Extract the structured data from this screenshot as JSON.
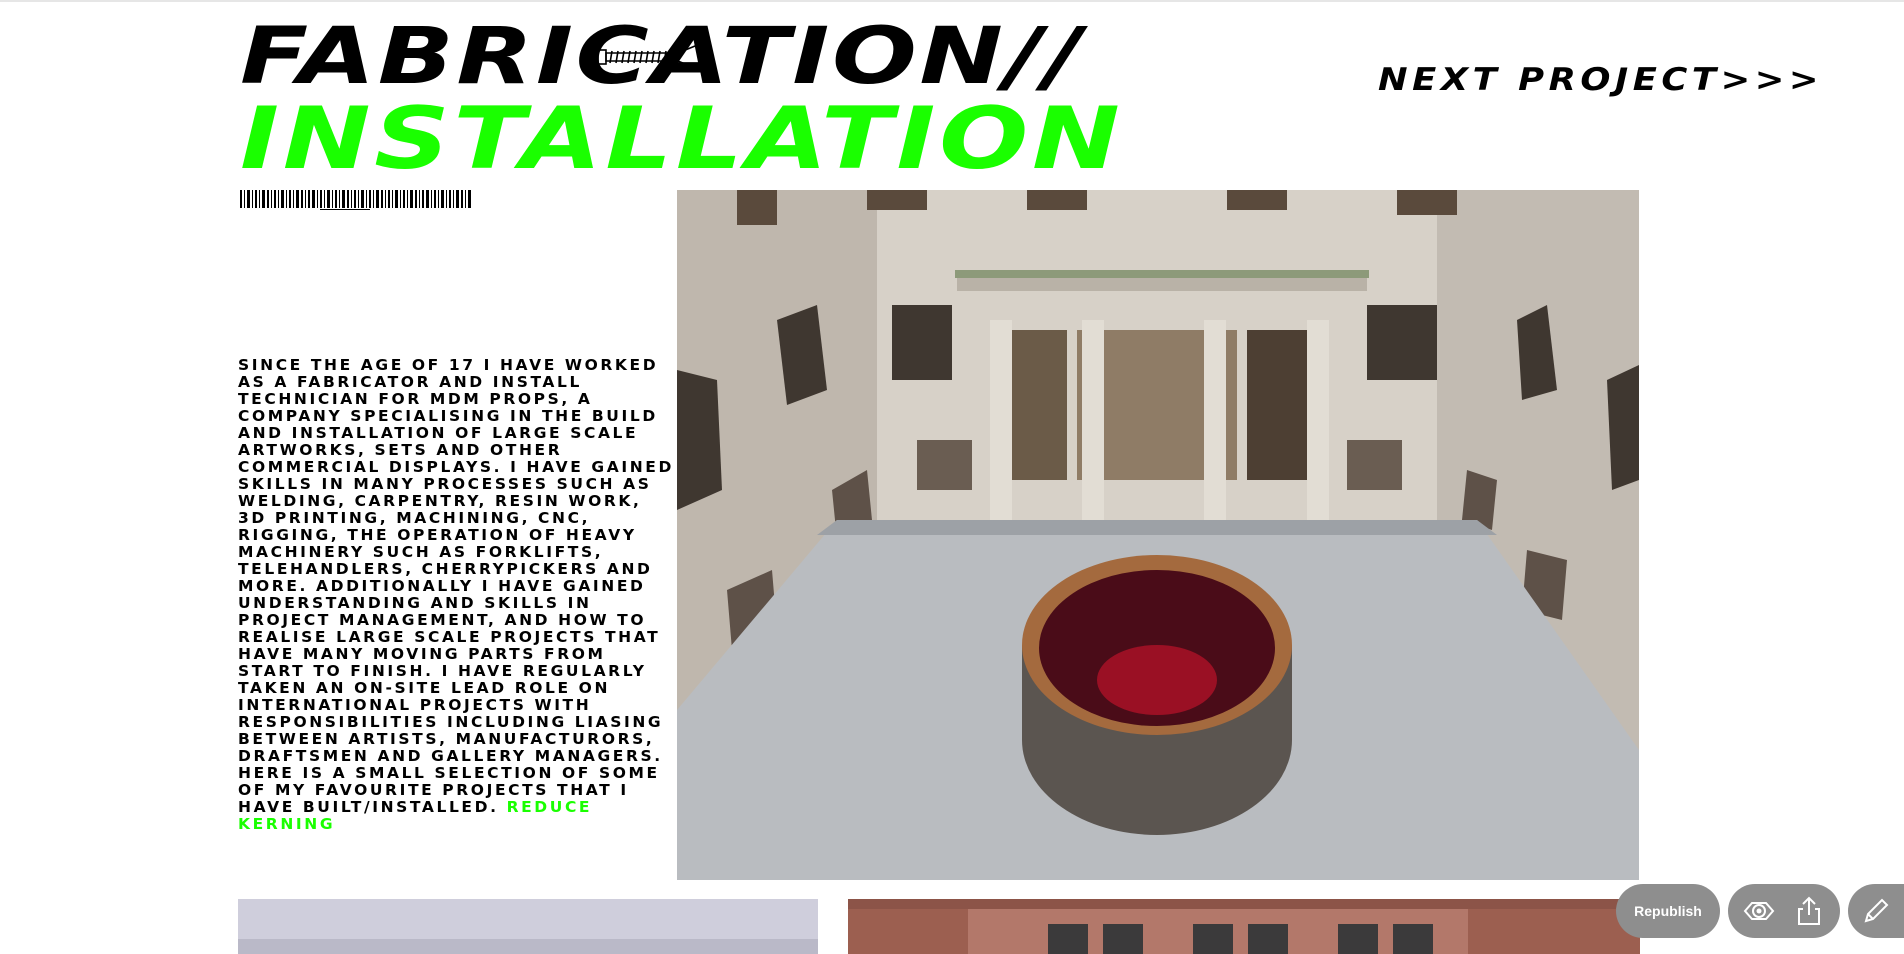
{
  "header": {
    "title_line1": "FABRICATION//",
    "title_line2": "INSTALLATION",
    "next_project": "NEXT PROJECT>>>"
  },
  "bio": {
    "text": "SINCE THE AGE OF 17 I HAVE WORKED AS A FABRICATOR AND INSTALL TECHNICIAN FOR MDM PROPS, A COMPANY SPECIALISING IN THE BUILD AND INSTALLATION OF LARGE SCALE ARTWORKS, SETS AND OTHER COMMERCIAL DISPLAYS. I HAVE GAINED SKILLS IN MANY PROCESSES SUCH AS WELDING, CARPENTRY, RESIN WORK, 3D PRINTING, MACHINING, CNC, RIGGING, THE OPERATION OF HEAVY MACHINERY SUCH AS FORKLIFTS, TELEHANDLERS, CHERRYPICKERS AND MORE. ADDITIONALLY I HAVE GAINED UNDERSTANDING AND SKILLS IN PROJECT MANAGEMENT, AND HOW TO REALISE LARGE SCALE PROJECTS THAT HAVE MANY MOVING PARTS FROM START TO FINISH. I HAVE REGULARLY TAKEN AN ON-SITE LEAD ROLE ON INTERNATIONAL PROJECTS WITH RESPONSIBILITIES INCLUDING LIASING BETWEEN ARTISTS, MANUFACTURORS, DRAFTSMEN AND GALLERY MANAGERS. HERE IS A SMALL SELECTION OF SOME OF MY FAVOURITE PROJECTS THAT I HAVE BUILT/INSTALLED. ",
    "link_text": "REDUCE KERNING"
  },
  "toolbar": {
    "republish_label": "Republish",
    "icons": [
      "eye-icon",
      "share-icon",
      "pencil-icon"
    ]
  },
  "colors": {
    "accent": "#1aff00",
    "text": "#000000",
    "toolbar_bg": "#8e8e8e"
  }
}
